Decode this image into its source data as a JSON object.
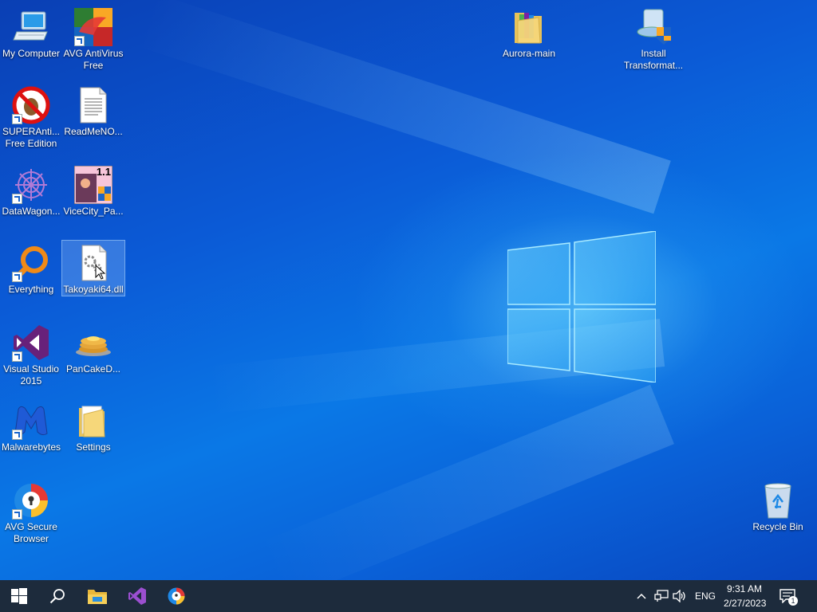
{
  "desktop_icons": [
    {
      "label": "My Computer",
      "icon": "computer-icon"
    },
    {
      "label": "AVG AntiVirus Free",
      "icon": "avg-antivirus-icon"
    },
    {
      "label": "SUPERAnti... Free Edition",
      "icon": "superantispyware-icon"
    },
    {
      "label": "ReadMeNO...",
      "icon": "text-document-icon"
    },
    {
      "label": "DataWagon...",
      "icon": "datawagon-icon"
    },
    {
      "label": "ViceCity_Pa...",
      "icon": "vicecity-patch-icon",
      "badge": "1.1"
    },
    {
      "label": "Everything",
      "icon": "everything-search-icon"
    },
    {
      "label": "Takoyaki64.dll",
      "icon": "dll-file-icon"
    },
    {
      "label": "Visual Studio 2015",
      "icon": "visual-studio-icon"
    },
    {
      "label": "PanCakeD...",
      "icon": "pancake-icon"
    },
    {
      "label": "Malwarebytes",
      "icon": "malwarebytes-icon"
    },
    {
      "label": "Settings",
      "icon": "folder-icon"
    },
    {
      "label": "AVG Secure Browser",
      "icon": "avg-browser-icon"
    },
    {
      "label": "Aurora-main",
      "icon": "folder-icon"
    },
    {
      "label": "Install Transformat...",
      "icon": "installer-icon"
    },
    {
      "label": "Recycle Bin",
      "icon": "recycle-bin-icon"
    }
  ],
  "taskbar": {
    "pinned": [
      "start-icon",
      "search-icon",
      "file-explorer-icon",
      "visual-studio-icon",
      "avg-browser-icon"
    ],
    "tray": {
      "language": "ENG",
      "time": "9:31 AM",
      "date": "2/27/2023",
      "notification_count": "1"
    }
  },
  "colors": {
    "taskbar": "#1d2b3c",
    "desktop_accent": "#0a78e6"
  }
}
